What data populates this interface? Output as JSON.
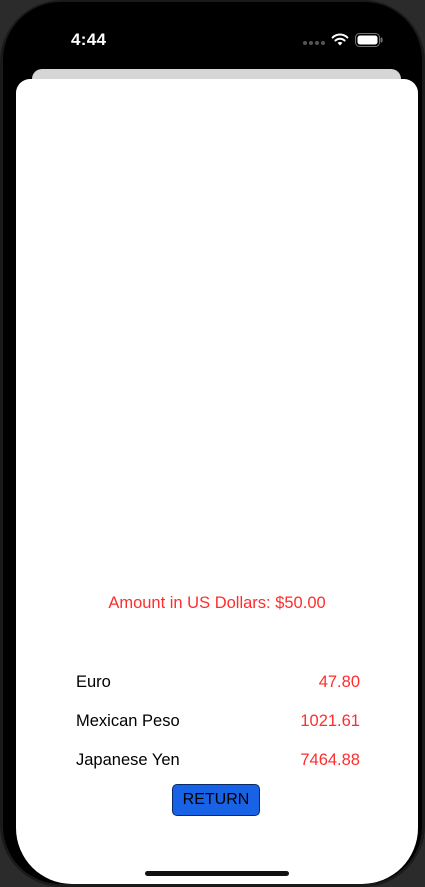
{
  "status_bar": {
    "time": "4:44",
    "wifi_icon": "wifi-icon",
    "battery_icon": "battery-icon"
  },
  "converter": {
    "amount_label": "Amount in US Dollars: $50.00",
    "rates": [
      {
        "currency": "Euro",
        "value": "47.80"
      },
      {
        "currency": "Mexican Peso",
        "value": "1021.61"
      },
      {
        "currency": "Japanese Yen",
        "value": "7464.88"
      }
    ],
    "return_label": "RETURN"
  },
  "colors": {
    "accent_red": "#ff2d2d",
    "button_blue": "#1862e6"
  }
}
